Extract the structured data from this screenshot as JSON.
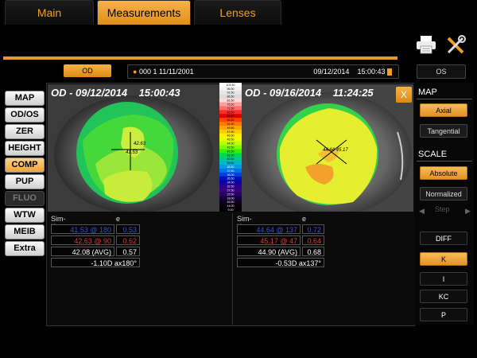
{
  "tabs": [
    {
      "label": "Main",
      "active": false
    },
    {
      "label": "Measurements",
      "active": true
    },
    {
      "label": "Lenses",
      "active": false
    }
  ],
  "toolbar": {
    "print_icon": "printer-icon",
    "tools_icon": "tools-icon"
  },
  "patient_bar": {
    "eye_left_button": "OD",
    "eye_right_button": "OS",
    "patient_info": "000  1   11/11/2001",
    "exam_date": "09/12/2014",
    "exam_time": "15:00:43"
  },
  "left_menu": [
    {
      "label": "MAP",
      "state": "normal"
    },
    {
      "label": "OD/OS",
      "state": "normal"
    },
    {
      "label": "ZER",
      "state": "normal"
    },
    {
      "label": "HEIGHT",
      "state": "normal"
    },
    {
      "label": "COMP",
      "state": "active"
    },
    {
      "label": "PUP",
      "state": "normal"
    },
    {
      "label": "FLUO",
      "state": "disabled"
    },
    {
      "label": "WTW",
      "state": "normal"
    },
    {
      "label": "MEIB",
      "state": "normal"
    },
    {
      "label": "Extra",
      "state": "normal"
    }
  ],
  "maps": {
    "left": {
      "title": "OD - 09/12/2014",
      "time": "15:00:43",
      "center_label_1": "42.63",
      "center_label_2": "41.53"
    },
    "right": {
      "title": "OD - 09/16/2014",
      "time": "11:24:25",
      "center_label": "44.64 45.17"
    },
    "close_label": "X"
  },
  "scale_values": [
    "101.50",
    "96.50",
    "91.50",
    "86.50",
    "81.50",
    "76.50",
    "71.50",
    "66.50",
    "61.50",
    "56.50",
    "51.50",
    "49.50",
    "47.50",
    "46.50",
    "45.50",
    "44.50",
    "43.50",
    "42.50",
    "41.50",
    "40.50",
    "39.50",
    "38.50",
    "37.50",
    "36.00",
    "35.50",
    "34.00",
    "32.50",
    "27.50",
    "22.50",
    "18.00",
    "16.50",
    "14.00",
    "9.00"
  ],
  "scale_colors": [
    "#ffffff",
    "#f2f2f2",
    "#e6e6e6",
    "#dadada",
    "#ffd7d7",
    "#ffa0a0",
    "#ff6e6e",
    "#ff2a2a",
    "#e00000",
    "#ff4000",
    "#ff7a00",
    "#ffa600",
    "#ffcc00",
    "#ffee00",
    "#e6ff00",
    "#b8ff00",
    "#7dff00",
    "#38f000",
    "#00d850",
    "#00c890",
    "#00b8c8",
    "#009ce0",
    "#0070e8",
    "#0040e0",
    "#0010c0",
    "#1000a0",
    "#2a0090",
    "#3a0080",
    "#2a0060",
    "#180040",
    "#100020",
    "#080010",
    "#000000"
  ],
  "left_table": {
    "header_simk": "Sim-K",
    "header_e": "e",
    "rows": [
      {
        "value": "41.53 @ 180",
        "e": "0.53",
        "color": "blue"
      },
      {
        "value": "42.63 @ 90",
        "e": "0.62",
        "color": "red"
      },
      {
        "value": "42.08 (AVG)",
        "e": "0.57",
        "color": "white"
      }
    ],
    "astig": "-1.10D ax180°"
  },
  "right_table": {
    "header_simk": "Sim-K",
    "header_e": "e",
    "rows": [
      {
        "value": "44.64 @ 137",
        "e": "0.72",
        "color": "blue"
      },
      {
        "value": "45.17 @ 47",
        "e": "0.64",
        "color": "red"
      },
      {
        "value": "44.90 (AVG)",
        "e": "0.68",
        "color": "white"
      }
    ],
    "astig": "-0.53D ax137°"
  },
  "right_panel": {
    "map_heading": "MAP",
    "axial": "Axial",
    "tangential": "Tangential",
    "scale_heading": "SCALE",
    "absolute": "Absolute",
    "normalized": "Normalized",
    "step": "Step",
    "diff": "DIFF",
    "k": "K",
    "i": "I",
    "kc": "KC",
    "p": "P"
  },
  "colors": {
    "accent": "#f0a238",
    "tab_line": "#e69a2a"
  }
}
